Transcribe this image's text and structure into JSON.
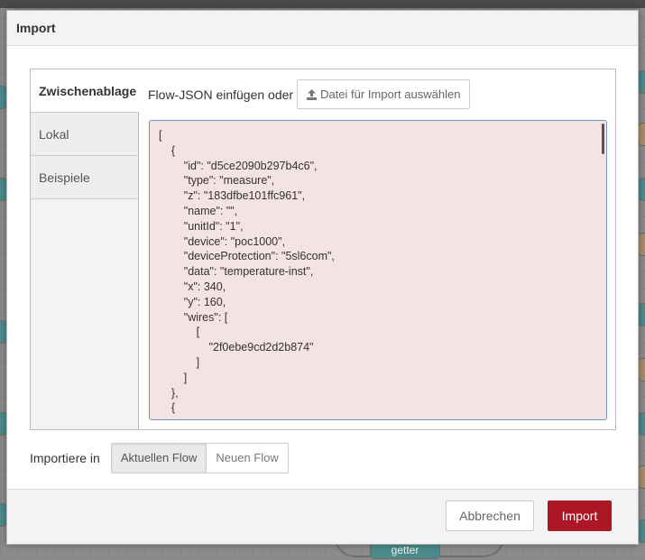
{
  "dialog": {
    "title": "Import"
  },
  "tabs": [
    {
      "label": "Zwischenablage",
      "active": true
    },
    {
      "label": "Lokal",
      "active": false
    },
    {
      "label": "Beispiele",
      "active": false
    }
  ],
  "clipboard": {
    "paste_label": "Flow-JSON einfügen oder",
    "file_button_label": "Datei für Import auswählen",
    "file_button_icon": "upload-icon",
    "json_lines": [
      "[",
      "    {",
      "        \"id\": \"d5ce2090b297b4c6\",",
      "        \"type\": \"measure\",",
      "        \"z\": \"183dfbe101ffc961\",",
      "        \"name\": \"\",",
      "        \"unitId\": \"1\",",
      "        \"device\": \"poc1000\",",
      "        \"deviceProtection\": \"5sl6com\",",
      "        \"data\": \"temperature-inst\",",
      "        \"x\": 340,",
      "        \"y\": 160,",
      "        \"wires\": [",
      "            [",
      "                \"2f0ebe9cd2d2b874\"",
      "            ]",
      "        ]",
      "    },",
      "    {"
    ]
  },
  "import_into": {
    "label": "Importiere in",
    "options": [
      {
        "label": "Aktuellen Flow",
        "selected": true
      },
      {
        "label": "Neuen Flow",
        "selected": false
      }
    ]
  },
  "footer": {
    "cancel_label": "Abbrechen",
    "import_label": "Import"
  },
  "background": {
    "visible_node_label": "getter"
  },
  "colors": {
    "primary_button": "#ad1625",
    "textarea_bg": "#f3e3e3",
    "textarea_border": "#6e93c9"
  }
}
